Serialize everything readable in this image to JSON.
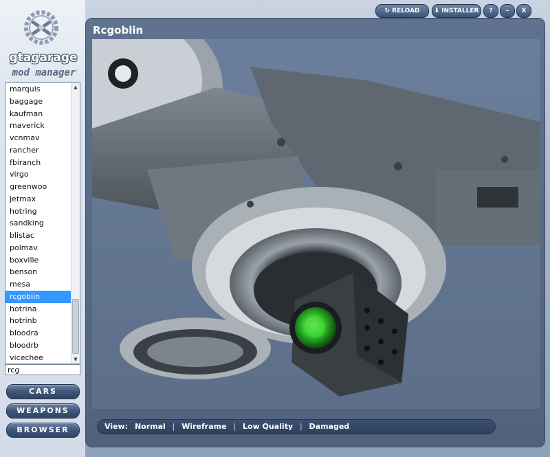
{
  "app": {
    "logo_word": "gtagarage",
    "logo_sub": "mod manager"
  },
  "window_buttons": {
    "reload": "RELOAD",
    "installer": "INSTALLER",
    "help": "?",
    "minimize": "–",
    "close": "X"
  },
  "sidebar": {
    "items": [
      "marquis",
      "baggage",
      "kaufman",
      "maverick",
      "vcnmav",
      "rancher",
      "fbiranch",
      "virgo",
      "greenwoo",
      "jetmax",
      "hotring",
      "sandking",
      "blistac",
      "polmav",
      "boxville",
      "benson",
      "mesa",
      "rcgoblin",
      "hotrina",
      "hotrinb",
      "bloodra",
      "bloodrb",
      "vicechee"
    ],
    "selected_index": 17,
    "search_value": "rcg",
    "nav": {
      "cars": "CARS",
      "weapons": "WEAPONS",
      "browser": "BROWSER"
    }
  },
  "main": {
    "title": "Rcgoblin",
    "view_label": "View:",
    "view_modes": [
      "Normal",
      "Wireframe",
      "Low Quality",
      "Damaged"
    ]
  }
}
